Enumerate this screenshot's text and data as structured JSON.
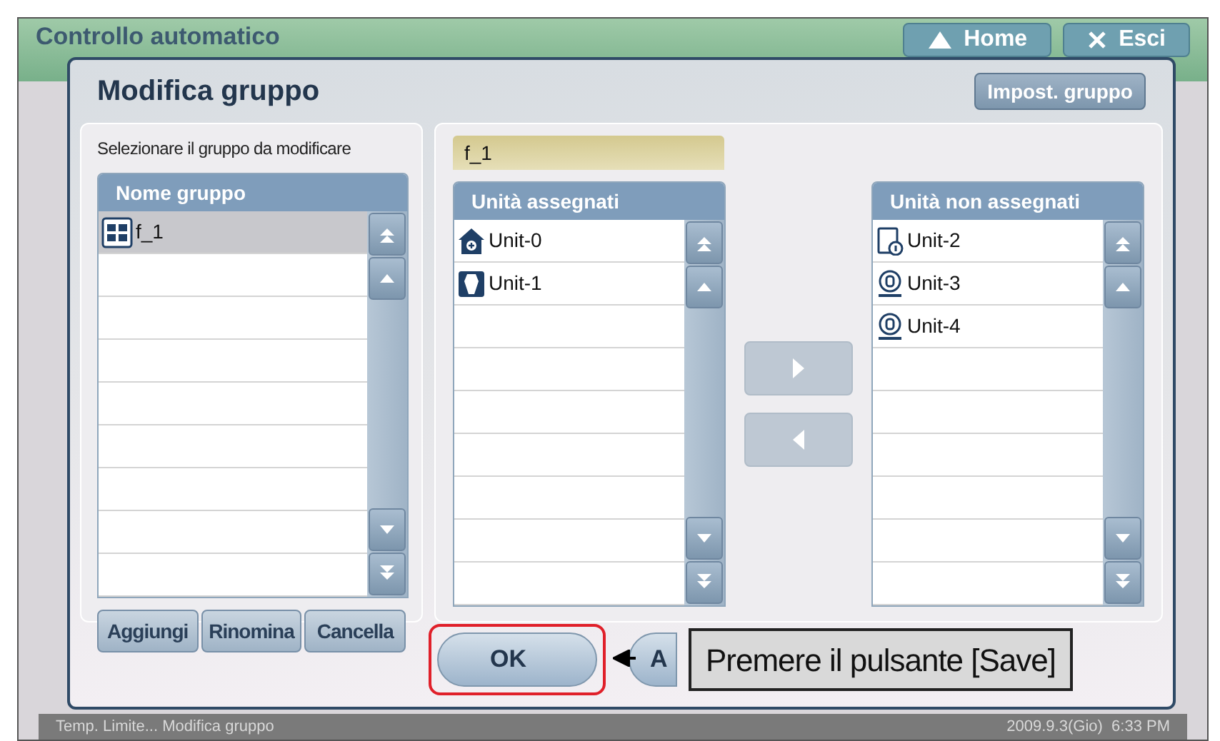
{
  "background_window": {
    "title": "Controllo automatico",
    "buttons": [
      {
        "label": "Home",
        "kind": "home"
      },
      {
        "label": "Esci",
        "kind": "exit"
      }
    ]
  },
  "dialog": {
    "title": "Modifica gruppo",
    "settings_button": "Impost. gruppo",
    "group_panel": {
      "instruction": "Selezionare il gruppo da modificare",
      "header": "Nome gruppo",
      "items": [
        {
          "label": "f_1",
          "selected": true
        }
      ],
      "buttons": [
        "Aggiungi",
        "Rinomina",
        "Cancella"
      ]
    },
    "group_name_field": {
      "value": "f_1"
    },
    "assigned": {
      "header": "Unità assegnati",
      "items": [
        {
          "label": "Unit-0",
          "kind": "house"
        },
        {
          "label": "Unit-1",
          "kind": "cassette"
        }
      ]
    },
    "unassigned": {
      "header": "Unità non assegnati",
      "items": [
        {
          "label": "Unit-2",
          "kind": "wall"
        },
        {
          "label": "Unit-3",
          "kind": "ahu"
        },
        {
          "label": "Unit-4",
          "kind": "ahu"
        }
      ]
    },
    "footer_buttons": [
      {
        "label": "OK",
        "highlighted": true
      },
      {
        "label": "A",
        "highlighted": false
      }
    ]
  },
  "callout": {
    "text": "Premere il pulsante [Save]"
  },
  "status_bar": {
    "left": "Temp. Limite... Modifica gruppo",
    "right": "2009.9.3(Gio)  6:33 PM"
  }
}
